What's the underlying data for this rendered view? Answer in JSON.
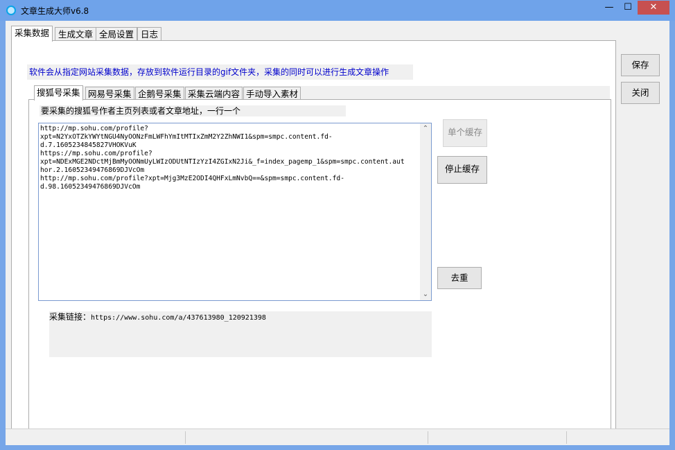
{
  "window": {
    "title": "文章生成大师v6.8",
    "min_glyph": "—",
    "max_glyph": "☐",
    "close_glyph": "✕"
  },
  "main_tabs": [
    "采集数据",
    "生成文章",
    "全局设置",
    "日志"
  ],
  "info_line": "软件会从指定网站采集数据，存放到软件运行目录的gif文件夹，采集的同时可以进行生成文章操作",
  "sub_tabs": [
    "搜狐号采集",
    "网易号采集",
    "企鹅号采集",
    "采集云端内容",
    "手动导入素材"
  ],
  "hint": "要采集的搜狐号作者主页列表或者文章地址，一行一个",
  "url_list": "http://mp.sohu.com/profile?\nxpt=N2YxOTZkYWYtNGU4NyOONzFmLWFhYmItMTIxZmM2Y2ZhNWI1&spm=smpc.content.fd-\nd.7.1605234845827VHOKVuK\nhttps://mp.sohu.com/profile?\nxpt=NDExMGE2NDctMjBmMyOONmUyLWIzODUtNTIzYzI4ZGIxN2Ji&_f=index_pagemp_1&spm=smpc.content.aut\nhor.2.16052349476869DJVcOm\nhttp://mp.sohu.com/profile?xpt=Mjg3MzE2ODI4QHFxLmNvbQ==&spm=smpc.content.fd-\nd.98.16052349476869DJVcOm",
  "buttons": {
    "single_cache": "单个缓存",
    "stop_cache": "停止缓存",
    "dedup": "去重",
    "save": "保存",
    "close": "关闭"
  },
  "status": {
    "label": "采集链接：",
    "url": "https://www.sohu.com/a/437613980_120921398"
  },
  "icons": {
    "app": "app-circle-icon",
    "scroll_up": "chevron-up-icon",
    "scroll_down": "chevron-down-icon"
  },
  "colors": {
    "titlebar": "#6fa3ea",
    "close_button": "#c75050",
    "info_text": "#0000cc"
  }
}
